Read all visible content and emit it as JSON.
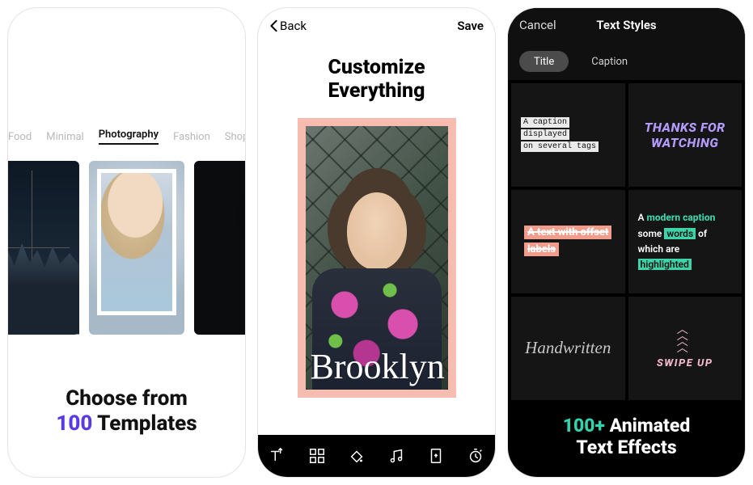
{
  "screen1": {
    "categories": [
      "Food",
      "Minimal",
      "Photography",
      "Fashion",
      "Shop"
    ],
    "active_category_index": 2,
    "headline_pre": "Choose from",
    "headline_num": "100",
    "headline_post": "Templates"
  },
  "screen2": {
    "back_label": "Back",
    "save_label": "Save",
    "title_line1": "Customize",
    "title_line2": "Everything",
    "script_text": "Brooklyn",
    "tools": [
      "text-icon",
      "layout-icon",
      "fill-icon",
      "music-icon",
      "aspect-icon",
      "timer-icon"
    ]
  },
  "screen3": {
    "cancel_label": "Cancel",
    "title": "Text Styles",
    "tabs": [
      "Title",
      "Caption"
    ],
    "active_tab_index": 0,
    "tiles": {
      "t1_line1": "A caption displayed",
      "t1_line2": "on several tags",
      "t2_line1": "THANKS FOR",
      "t2_line2": "WATCHING",
      "t3_line1": "A text with offset",
      "t3_line2": "labels",
      "t4_pre": "A ",
      "t4_h1": "modern caption",
      "t4_mid": " some ",
      "t4_h2a": "words",
      "t4_mid2": " of which are ",
      "t4_h2b": "highlighted",
      "t5": "Handwritten",
      "t6_label": "SWIPE UP"
    },
    "headline_num": "100+",
    "headline_line1_post": " Animated",
    "headline_line2": "Text Effects"
  }
}
